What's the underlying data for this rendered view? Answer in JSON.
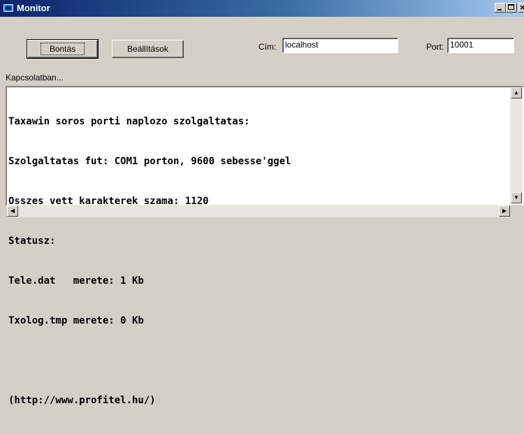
{
  "window": {
    "title": "Monitor"
  },
  "toolbar": {
    "disconnect_label": "Bontás",
    "settings_label": "Beállítások",
    "address_label": "Cím:",
    "address_value": "localhost",
    "port_label": "Port:",
    "port_value": "10001"
  },
  "status": {
    "text": "Kapcsolatban..."
  },
  "console": {
    "lines": [
      "Taxawin soros porti naplozo szolgaltatas:",
      "Szolgaltatas fut: COM1 porton, 9600 sebesse'ggel",
      "Osszes vett karakterek szama: 1120",
      "Statusz:",
      "Tele.dat   merete: 1 Kb",
      "Txolog.tmp merete: 0 Kb",
      "",
      "(http://www.profitel.hu/)"
    ]
  },
  "icons": {
    "app": "monitor-icon",
    "minimize": "minimize-icon",
    "maximize": "maximize-icon",
    "close": "close-icon",
    "scroll_up": "arrow-up-icon",
    "scroll_down": "arrow-down-icon",
    "scroll_left": "arrow-left-icon",
    "scroll_right": "arrow-right-icon"
  },
  "colors": {
    "titlebar_start": "#0a246a",
    "titlebar_end": "#a6caf0",
    "face": "#d4d0c8"
  }
}
